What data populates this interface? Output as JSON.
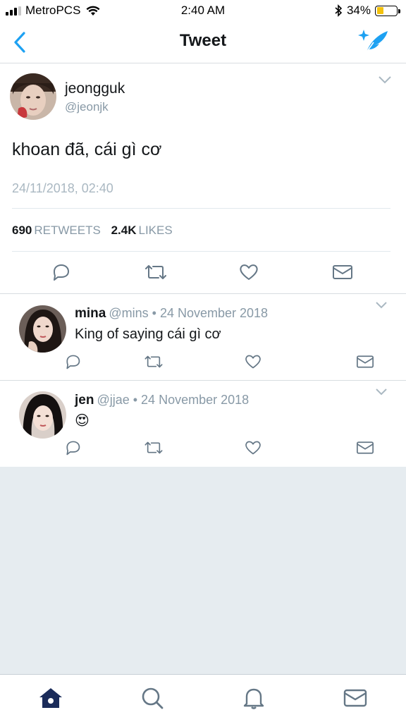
{
  "status_bar": {
    "carrier": "MetroPCS",
    "time": "2:40 AM",
    "battery": "34%",
    "battery_level": 0.34,
    "signal_bars": 3,
    "icons": [
      "signal-icon",
      "wifi-icon",
      "bluetooth-icon",
      "battery-icon"
    ]
  },
  "header": {
    "title": "Tweet",
    "back_icon": "chevron-left-icon",
    "compose_icon": "compose-tweet-icon"
  },
  "main_tweet": {
    "name": "jeongguk",
    "handle": "@jeonjk",
    "text": "khoan đã, cái gì cơ",
    "date": "24/11/2018, 02:40",
    "retweets_count": "690",
    "retweets_label": "RETWEETS",
    "likes_count": "2.4K",
    "likes_label": "LIKES",
    "actions": [
      "reply-icon",
      "retweet-icon",
      "like-icon",
      "message-icon"
    ]
  },
  "replies": [
    {
      "name": "mina",
      "meta": "@mins • 24 November 2018",
      "text": "King of saying cái gì cơ"
    },
    {
      "name": "jen",
      "meta": "@jjae • 24 November 2018",
      "text": "😍"
    }
  ],
  "tab_bar": {
    "items": [
      "home-icon",
      "search-icon",
      "notifications-icon",
      "messages-icon"
    ]
  },
  "colors": {
    "accent": "#1da1f2",
    "muted": "#8899a6",
    "icon_dark": "#657786",
    "home_active": "#1b2c5a",
    "background_grey": "#e6ecf0"
  }
}
